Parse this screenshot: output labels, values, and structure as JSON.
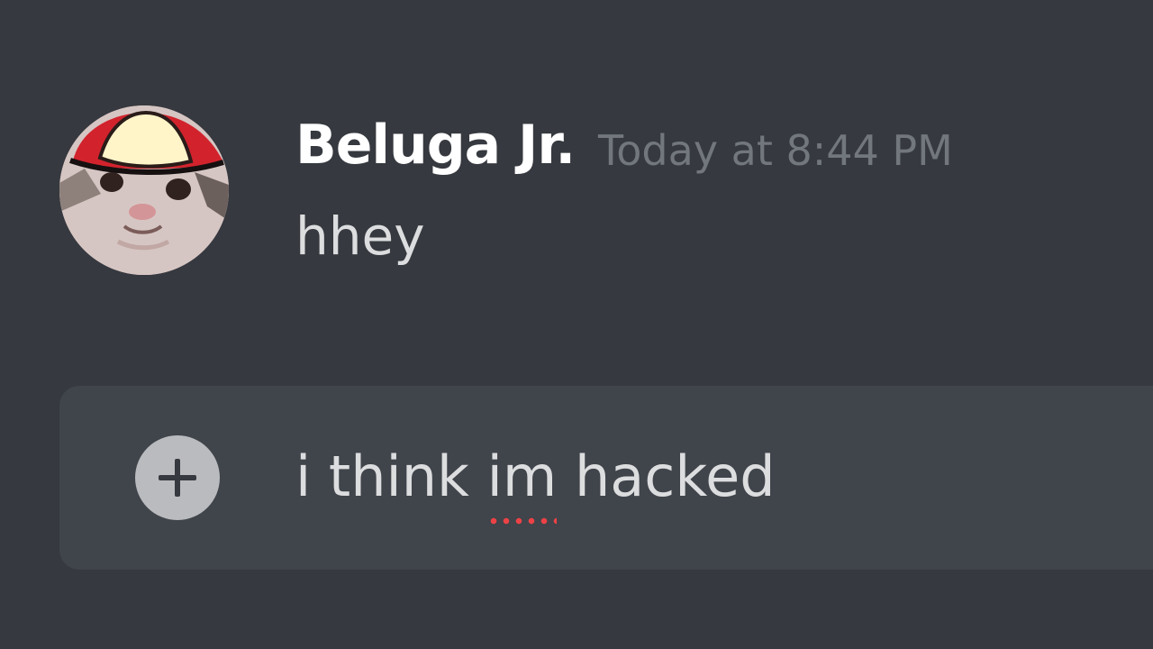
{
  "message": {
    "author": "Beluga Jr.",
    "timestamp": "Today at 8:44 PM",
    "text": "hhey"
  },
  "composer": {
    "text_before": "i think ",
    "misspelled_word": "im",
    "text_after": " hacked",
    "attach_icon": "plus-circle-icon"
  },
  "colors": {
    "background": "#36393f",
    "composer": "#40444b",
    "username": "#ffffff",
    "timestamp": "#72767d",
    "spellcheck": "#ed4245"
  }
}
